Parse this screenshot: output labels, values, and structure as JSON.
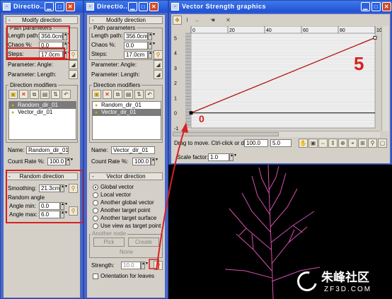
{
  "win1": {
    "title": "Directio..."
  },
  "win2": {
    "title": "Directio..."
  },
  "win3": {
    "title": "Vector Strength graphics"
  },
  "p1": {
    "rollout": "Modify direction",
    "path_group": "Path parameters",
    "length_label": "Length path:",
    "length_value": "356.0cm",
    "chaos_label": "Chaos %:",
    "chaos_value": "0.0",
    "steps_label": "Steps:",
    "steps_value": "17.0cm",
    "param_angle": "Parameter: Angle:",
    "param_length": "Parameter: Length:",
    "modifiers_group": "Direction modifiers",
    "list": [
      "Random_dir_01",
      "Vector_dir_01"
    ],
    "name_label": "Name:",
    "name_value": "Random_dir_01",
    "count_label": "Count Rate %:",
    "count_value": "100.0",
    "random_rollout": "Random direction",
    "smoothing_label": "Smoothing:",
    "smoothing_value": "21.3cm",
    "random_angle": "Random angle",
    "angle_min_label": "Angle min:",
    "angle_min_value": "0.0",
    "angle_max_label": "Angle max:",
    "angle_max_value": "6.0"
  },
  "p2": {
    "rollout": "Modify direction",
    "path_group": "Path parameters",
    "length_label": "Length path:",
    "length_value": "356.0cm",
    "chaos_label": "Chaos %:",
    "chaos_value": "0.0",
    "steps_label": "Steps:",
    "steps_value": "17.0cm",
    "param_angle": "Parameter: Angle:",
    "param_length": "Parameter: Length:",
    "modifiers_group": "Direction modifiers",
    "list": [
      "Random_dir_01",
      "Vector_dir_01"
    ],
    "name_label": "Name:",
    "name_value": "Vector_dir_01",
    "count_label": "Count Rate %:",
    "count_value": "100.0",
    "vector_rollout": "Vector direction",
    "radios": [
      "Global vector",
      "Local vector",
      "Another global vector",
      "Another target point",
      "Another target surface",
      "Use view as target point"
    ],
    "another_node": "Another node",
    "pick": "Pick",
    "create": "Create",
    "none": "None",
    "strength_label": "Strength:",
    "strength_value": "10.0",
    "orient_label": "Orientation for leaves"
  },
  "graph": {
    "y_ticks": [
      "5",
      "4",
      "3",
      "2",
      "1",
      "0",
      "-1"
    ],
    "x_ticks": [
      "0",
      "20",
      "40",
      "60",
      "80",
      "10"
    ],
    "status": "Drag to move. Ctrl-click or drag",
    "field_a": "100.0",
    "field_b": "5.0",
    "scale_label": "Scale factor:",
    "scale_value": "1.0"
  },
  "chart_data": {
    "type": "line",
    "x": [
      0,
      100
    ],
    "y": [
      0,
      5
    ],
    "xlim": [
      0,
      100
    ],
    "ylim": [
      -1,
      5.3
    ]
  },
  "annotations": {
    "start": "0",
    "end": "5"
  },
  "watermark": {
    "cn": "朱峰社区",
    "url": "ZF3D.COM"
  }
}
